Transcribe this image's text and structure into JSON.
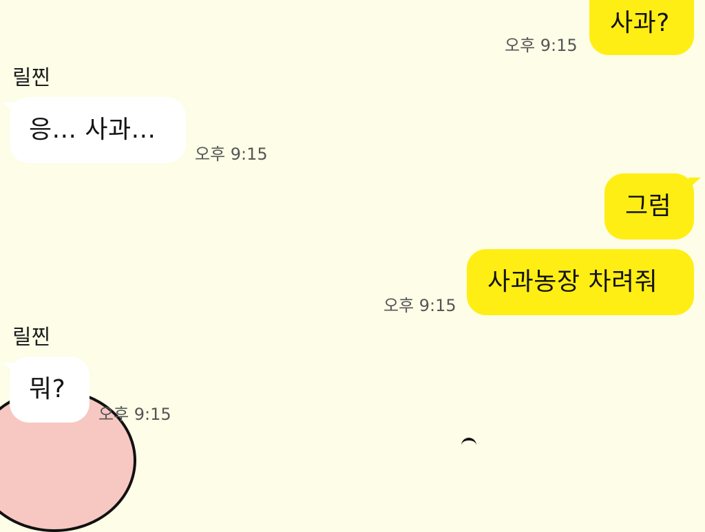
{
  "chat": {
    "messages": [
      {
        "direction": "out",
        "sender": "",
        "text": "사과?",
        "time": "오후 9:15"
      },
      {
        "direction": "in",
        "sender": "릴찐",
        "text": "응... 사과...",
        "time": "오후 9:15"
      },
      {
        "direction": "out",
        "sender": "",
        "text": "그럼",
        "time": ""
      },
      {
        "direction": "out",
        "sender": "",
        "text": "사과농장 차려줘",
        "time": "오후 9:15"
      },
      {
        "direction": "in",
        "sender": "릴찐",
        "text": "뭐?",
        "time": "오후 9:15"
      }
    ]
  },
  "colors": {
    "background": "#fdfde8",
    "outgoing_bubble": "#ffee14",
    "incoming_bubble": "#ffffff",
    "sticker_fill": "#f7c7c2"
  }
}
